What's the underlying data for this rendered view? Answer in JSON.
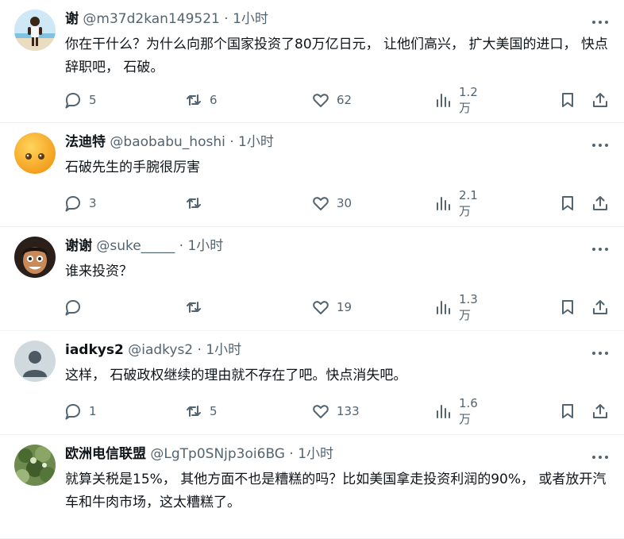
{
  "posts": [
    {
      "name": "谢",
      "handle": "@m37d2kan149521",
      "sep": "·",
      "time": "1小时",
      "text": "你在干什么？为什么向那个国家投资了80万亿日元， 让他们高兴， 扩大美国的进口， 快点辞职吧， 石破。",
      "replies": "5",
      "retweets": "6",
      "likes": "62",
      "views": "1.2万",
      "avatar_icon": "person-on-beach-avatar"
    },
    {
      "name": "法迪特",
      "handle": "@baobabu_hoshi",
      "sep": "·",
      "time": "1小时",
      "text": "石破先生的手腕很厉害",
      "replies": "3",
      "retweets": "",
      "likes": "30",
      "views": "2.1万",
      "avatar_icon": "orange-face-avatar"
    },
    {
      "name": "谢谢",
      "handle": "@suke_____",
      "sep": "·",
      "time": "1小时",
      "text": "谁来投资？",
      "replies": "",
      "retweets": "",
      "likes": "19",
      "views": "1.3万",
      "avatar_icon": "cartoon-character-avatar"
    },
    {
      "name": "iadkys2",
      "handle": "@iadkys2",
      "sep": "·",
      "time": "1小时",
      "text": "这样， 石破政权继续的理由就不存在了吧。快点消失吧。",
      "replies": "1",
      "retweets": "5",
      "likes": "133",
      "views": "1.6万",
      "avatar_icon": "default-user-avatar"
    },
    {
      "name": "欧洲电信联盟",
      "handle": "@LgTp0SNjp3oi6BG",
      "sep": "·",
      "time": "1小时",
      "text": "就算关税是15%， 其他方面不也是糟糕的吗？比如美国拿走投资利润的90%， 或者放开汽车和牛肉市场，这太糟糕了。",
      "avatar_icon": "foliage-avatar"
    }
  ],
  "colors": {
    "text": "#0f1419",
    "secondary": "#536471",
    "divider": "#eff3f4"
  }
}
